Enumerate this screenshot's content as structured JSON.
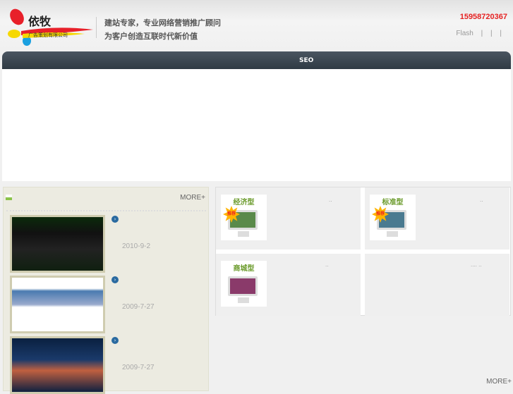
{
  "brand": {
    "name": "依牧",
    "sub": "广告策划有限公司"
  },
  "header": {
    "slogan1": "建站专家，专业网络营销推广顾问",
    "slogan2": "为客户创造互联时代新价值",
    "phone": "15958720367",
    "links": "Flash | | |"
  },
  "nav": {
    "title": "SEO"
  },
  "cases": {
    "more": "MORE+",
    "items": [
      {
        "date": "2010-9-2"
      },
      {
        "date": "2009-7-27"
      },
      {
        "date": "2009-7-27"
      }
    ]
  },
  "products": {
    "more": "MORE+",
    "badge": "推荐",
    "items": [
      {
        "title": "经济型",
        "note": ".."
      },
      {
        "title": "标准型",
        "note": ".."
      },
      {
        "title": "商城型",
        "note": ".."
      },
      {
        "title": "",
        "note": "....  .."
      }
    ]
  },
  "colors": {
    "accent": "#e52222",
    "nav": "#36414b",
    "green": "#6a9a2a"
  }
}
